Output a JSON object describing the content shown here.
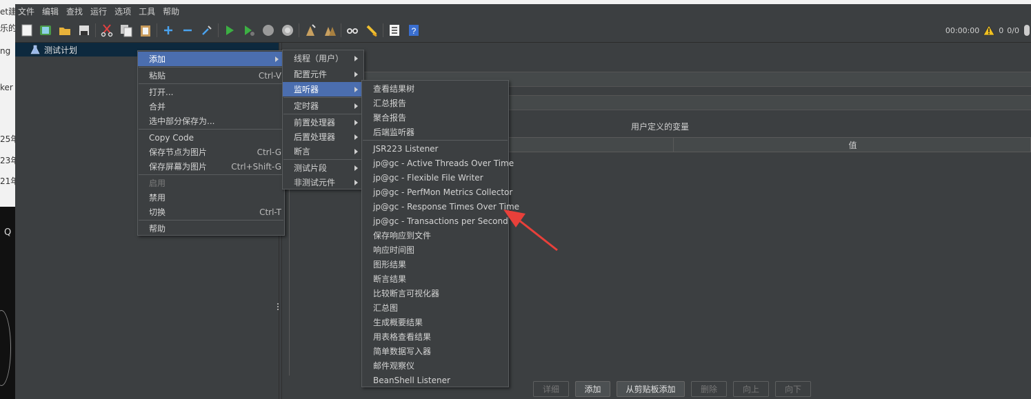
{
  "background": {
    "fragments": [
      "et建",
      "乐的.",
      "ng",
      "ker",
      "25年",
      "23年",
      "21年"
    ],
    "q": "Q"
  },
  "menubar": [
    "文件",
    "编辑",
    "查找",
    "运行",
    "选项",
    "工具",
    "帮助"
  ],
  "toolbar": {
    "icons": [
      "new-icon",
      "templates-icon",
      "open-icon",
      "save-icon",
      "cut-icon",
      "copy-icon",
      "paste-icon",
      "expand-icon",
      "collapse-icon",
      "toggle-icon",
      "start-icon",
      "start-no-pause-icon",
      "stop-icon",
      "shutdown-icon",
      "clear-icon",
      "clear-all-icon",
      "search-icon",
      "reset-search-icon",
      "function-helper-icon",
      "help-icon"
    ],
    "timer": "00:00:00",
    "warnings": "0",
    "threads": "0/0"
  },
  "tree": {
    "root_label": "测试计划"
  },
  "colors": {
    "accent": "#4b6eaf",
    "tree_selected": "#0d293e",
    "arrow": "#e8403a"
  },
  "context_menu": {
    "items": [
      {
        "label": "添加",
        "shortcut": "",
        "submenu": true,
        "highlighted": true
      },
      {
        "label": "粘贴",
        "shortcut": "Ctrl-V"
      },
      {
        "label": "打开...",
        "shortcut": ""
      },
      {
        "label": "合并",
        "shortcut": ""
      },
      {
        "label": "选中部分保存为...",
        "shortcut": ""
      },
      {
        "label": "Copy Code",
        "shortcut": ""
      },
      {
        "label": "保存节点为图片",
        "shortcut": "Ctrl-G"
      },
      {
        "label": "保存屏幕为图片",
        "shortcut": "Ctrl+Shift-G"
      },
      {
        "label": "启用",
        "shortcut": "",
        "disabled": true
      },
      {
        "label": "禁用",
        "shortcut": ""
      },
      {
        "label": "切换",
        "shortcut": "Ctrl-T"
      },
      {
        "label": "帮助",
        "shortcut": ""
      }
    ]
  },
  "add_submenu": {
    "items": [
      "线程（用户）",
      "配置元件",
      "监听器",
      "定时器",
      "前置处理器",
      "后置处理器",
      "断言",
      "测试片段",
      "非测试元件"
    ]
  },
  "listener_submenu": {
    "items": [
      "查看结果树",
      "汇总报告",
      "聚合报告",
      "后端监听器",
      "JSR223 Listener",
      "jp@gc - Active Threads Over Time",
      "jp@gc - Flexible File Writer",
      "jp@gc - PerfMon Metrics Collector",
      "jp@gc - Response Times Over Time",
      "jp@gc - Transactions per Second",
      "保存响应到文件",
      "响应时间图",
      "图形结果",
      "断言结果",
      "比较断言可视化器",
      "汇总图",
      "生成概要结果",
      "用表格查看结果",
      "简单数据写入器",
      "邮件观察仪",
      "BeanShell Listener"
    ]
  },
  "right_panel": {
    "vars_title": "用户定义的变量",
    "value_header": "值",
    "buttons": [
      {
        "label": "详细",
        "enabled": false
      },
      {
        "label": "添加",
        "enabled": true
      },
      {
        "label": "从剪贴板添加",
        "enabled": true
      },
      {
        "label": "删除",
        "enabled": false
      },
      {
        "label": "向上",
        "enabled": false
      },
      {
        "label": "向下",
        "enabled": false
      }
    ]
  }
}
